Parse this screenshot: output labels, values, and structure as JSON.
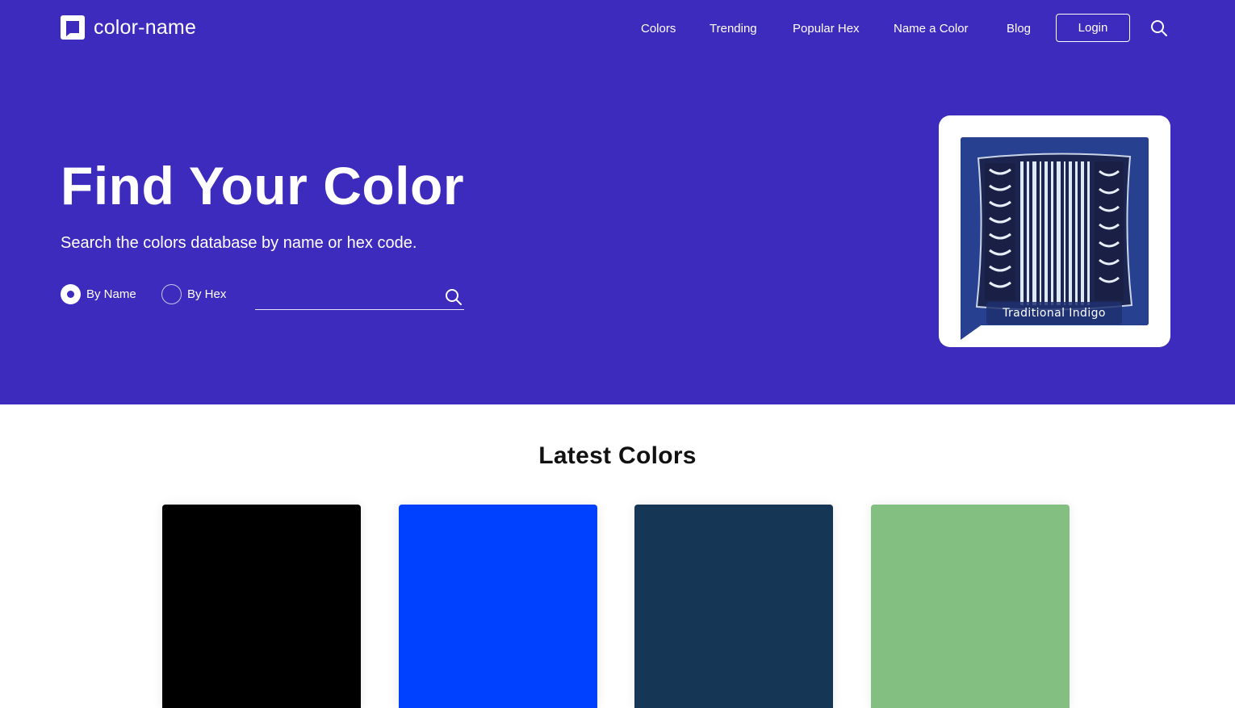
{
  "brand": {
    "name": "color-name",
    "logo_icon": "speech-bubble-icon"
  },
  "nav": {
    "items": [
      {
        "label": "Colors"
      },
      {
        "label": "Trending"
      },
      {
        "label": "Popular Hex"
      },
      {
        "label": "Name a Color"
      },
      {
        "label": "Blog"
      }
    ],
    "login_label": "Login",
    "search_icon": "search-icon"
  },
  "hero": {
    "title": "Find Your Color",
    "subtitle": "Search the colors database by name or hex code.",
    "search_modes": [
      {
        "label": "By Name",
        "selected": true
      },
      {
        "label": "By Hex",
        "selected": false
      }
    ],
    "search_value": "",
    "search_placeholder": ""
  },
  "featured": {
    "label": "Traditional Indigo",
    "image": "indigo-patterned-pillow",
    "image_background": "#27408f"
  },
  "latest": {
    "title": "Latest Colors",
    "swatches": [
      {
        "color": "#000000"
      },
      {
        "color": "#0041ff"
      },
      {
        "color": "#163656"
      },
      {
        "color": "#82bf80"
      }
    ]
  },
  "theme": {
    "accent": "#3d2bbe",
    "text_light": "#ffffff"
  }
}
